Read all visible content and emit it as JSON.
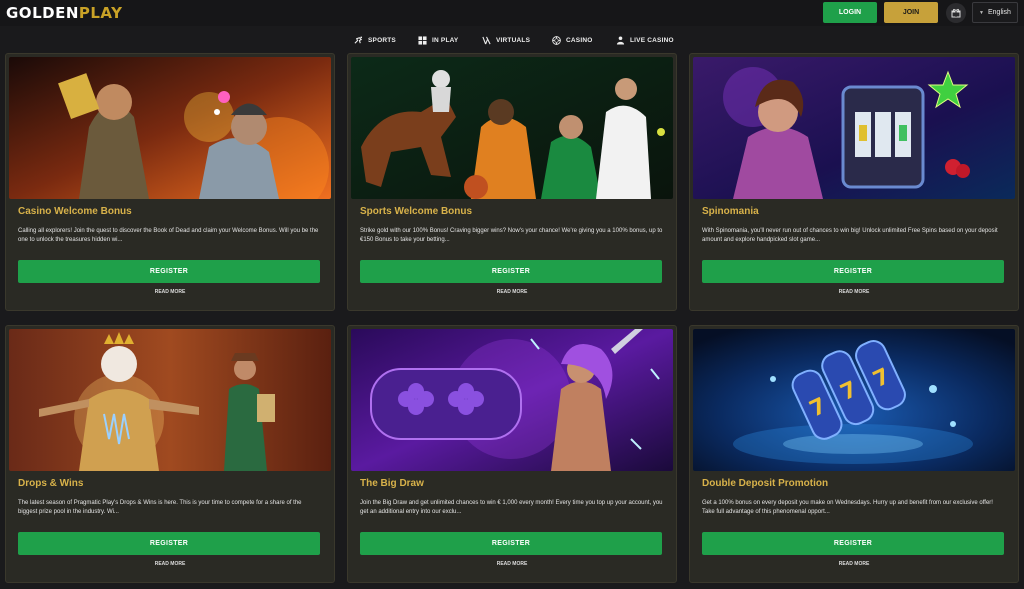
{
  "header": {
    "logo_primary": "GOLDEN",
    "logo_accent": "PLAY",
    "login_label": "LOGIN",
    "join_label": "JOIN",
    "gift_icon": "gift-icon",
    "language": "English"
  },
  "nav": {
    "items": [
      {
        "label": "SPORTS",
        "icon": "sports-icon"
      },
      {
        "label": "IN PLAY",
        "icon": "in-play-icon"
      },
      {
        "label": "VIRTUALS",
        "icon": "virtuals-icon"
      },
      {
        "label": "CASINO",
        "icon": "casino-chip-icon"
      },
      {
        "label": "LIVE CASINO",
        "icon": "live-casino-icon"
      }
    ]
  },
  "promotions": [
    {
      "title": "Casino Welcome Bonus",
      "description": "Calling all explorers! Join the quest to discover the Book of Dead and claim your Welcome Bonus. Will you be the one to unlock the treasures hidden wi...",
      "register_label": "REGISTER",
      "read_more_label": "READ MORE"
    },
    {
      "title": "Sports Welcome Bonus",
      "description": "Strike gold with our 100% Bonus!   Craving bigger wins? Now's your chance! We're giving you a 100% bonus, up to €150 Bonus to take your betting...",
      "register_label": "REGISTER",
      "read_more_label": "READ MORE"
    },
    {
      "title": "Spinomania",
      "description": "With Spinomania, you'll never run out of chances to win big! Unlock unlimited Free Spins based on your deposit amount and explore handpicked slot game...",
      "register_label": "REGISTER",
      "read_more_label": "READ MORE"
    },
    {
      "title": "Drops & Wins",
      "description": "The latest season of Pragmatic Play's Drops & Wins is here. This is your time to compete for a share of the biggest prize pool in the industry. Wi...",
      "register_label": "REGISTER",
      "read_more_label": "READ MORE"
    },
    {
      "title": "The Big Draw",
      "description": "Join the Big Draw and get unlimited chances to win € 1,000 every month! Every time you top up your account, you get an additional entry into our exclu...",
      "register_label": "REGISTER",
      "read_more_label": "READ MORE"
    },
    {
      "title": "Double Deposit Promotion",
      "description": "Get a 100% bonus on every deposit you make on Wednesdays. Hurry up and benefit from our exclusive offer! Take full advantage of this phenomenal opport...",
      "register_label": "REGISTER",
      "read_more_label": "READ MORE"
    }
  ],
  "colors": {
    "background": "#1a1a1c",
    "card": "#2a2a24",
    "title_gold": "#d8b24a",
    "register_green": "#1fa04a",
    "join_gold": "#c7a13a"
  }
}
